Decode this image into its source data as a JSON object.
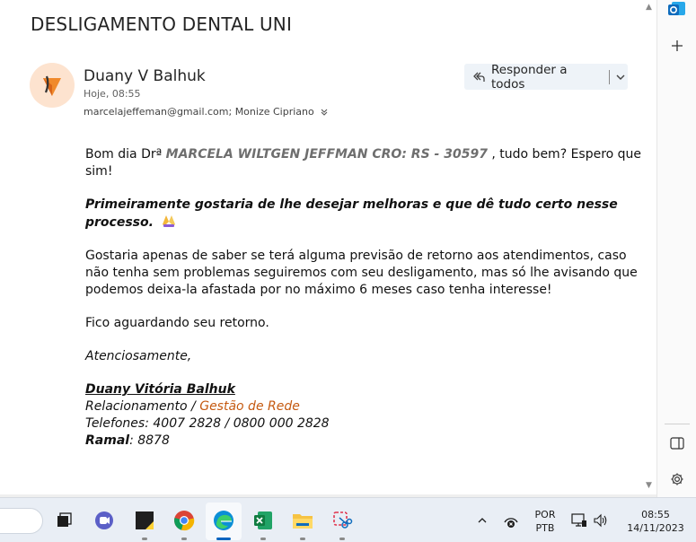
{
  "email": {
    "subject": "DESLIGAMENTO DENTAL UNI",
    "sender_name": "Duany V Balhuk",
    "time": "Hoje, 08:55",
    "recipients": "marcelajeffeman@gmail.com; Monize Cipriano",
    "reply_all_label": "Responder a todos",
    "body": {
      "greeting_start": "Bom dia Drª ",
      "greeting_name": "MARCELA WILTGEN JEFFMAN CRO: RS - 30597",
      "greeting_end": " , tudo bem? Espero que sim!",
      "wish": "Primeiramente gostaria de lhe desejar melhoras e que dê tudo certo nesse processo.",
      "paragraph": "Gostaria apenas de saber se terá alguma previsão de retorno aos atendimentos, caso não tenha sem problemas seguiremos com seu desligamento, mas só lhe avisando que podemos deixa-la afastada por no máximo 6 meses caso tenha interesse!",
      "closing_line": "Fico aguardando seu retorno.",
      "regards": "Atenciosamente,"
    },
    "signature": {
      "name": "Duany Vitória Balhuk ",
      "role_prefix": "Relacionamento / ",
      "role_dept": "Gestão de Rede",
      "phones": "Telefones: 4007 2828 / 0800 000 2828",
      "ramal_label": "Ramal",
      "ramal_value": ": 8878"
    }
  },
  "side_rail": {
    "icons": [
      "outlook-icon",
      "add-icon",
      "panel-icon",
      "settings-icon"
    ]
  },
  "taskbar": {
    "apps": [
      "task-view-icon",
      "teams-icon",
      "sticky-notes-icon",
      "chrome-icon",
      "edge-icon",
      "excel-icon",
      "file-explorer-icon",
      "snipping-tool-icon"
    ],
    "language_line1": "POR",
    "language_line2": "PTB",
    "clock_time": "08:55",
    "clock_date": "14/11/2023"
  },
  "colors": {
    "accent_orange": "#c55a11",
    "avatar_bg": "#fde3cf",
    "outlook_blue": "#0f6cbd"
  }
}
